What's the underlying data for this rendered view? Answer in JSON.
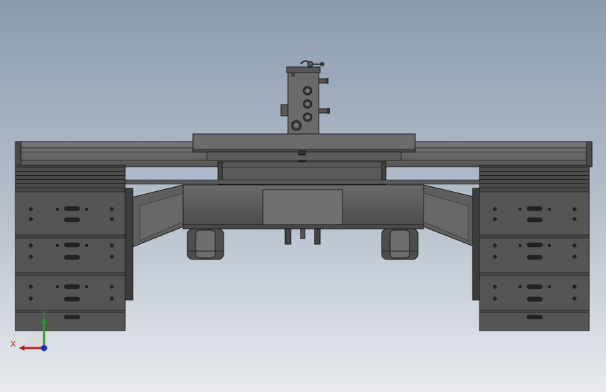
{
  "axes": {
    "x_label": "X",
    "y_label": "Y",
    "x_color": "#b02020",
    "y_color": "#20a020",
    "z_color": "#2030c0"
  },
  "colors": {
    "background_top": "#8b9cb0",
    "background_bottom": "#e8eaee",
    "body_light": "#6f6f6f",
    "body_mid": "#5a5a5a",
    "body_dark": "#3e3e3e",
    "edge": "#1c1c1c"
  }
}
